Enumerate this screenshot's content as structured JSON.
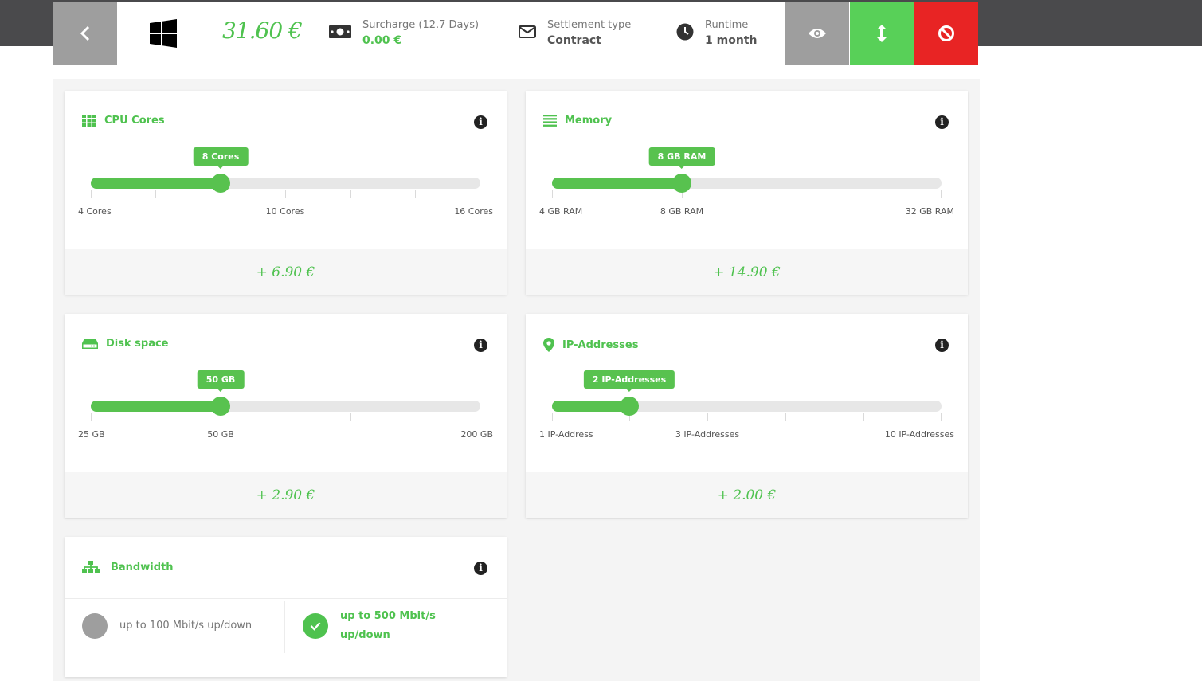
{
  "topbar": {
    "total_price": "31.60 €",
    "surcharge_label": "Surcharge (12.7 Days)",
    "surcharge_value": "0.00 €",
    "settlement_label": "Settlement type",
    "settlement_value": "Contract",
    "runtime_label": "Runtime",
    "runtime_value": "1 month"
  },
  "cards": {
    "cpu": {
      "title": "CPU Cores",
      "bubble": "8 Cores",
      "min": "4 Cores",
      "mid": "10 Cores",
      "max": "16 Cores",
      "price": "+ 6.90 €",
      "fill_fraction": 0.333
    },
    "memory": {
      "title": "Memory",
      "bubble": "8 GB RAM",
      "min": "4 GB RAM",
      "mid": "8 GB RAM",
      "max": "32 GB RAM",
      "price": "+ 14.90 €",
      "fill_fraction": 0.333
    },
    "disk": {
      "title": "Disk space",
      "bubble": "50 GB",
      "min": "25 GB",
      "mid": "50 GB",
      "max": "200 GB",
      "price": "+ 2.90 €",
      "fill_fraction": 0.333
    },
    "ip": {
      "title": "IP-Addresses",
      "bubble": "2 IP-Addresses",
      "min": "1 IP-Address",
      "mid": "3 IP-Addresses",
      "max": "10 IP-Addresses",
      "price": "+ 2.00 €",
      "fill_fraction": 0.2
    }
  },
  "bandwidth": {
    "title": "Bandwidth",
    "option1": "up to 100 Mbit/s up/down",
    "option2_line1": "up to 500 Mbit/s",
    "option2_line2": "up/down",
    "selected": "option2"
  },
  "colors": {
    "accent": "#4fc24f",
    "danger": "#e82424",
    "neutral": "#9e9e9e"
  }
}
